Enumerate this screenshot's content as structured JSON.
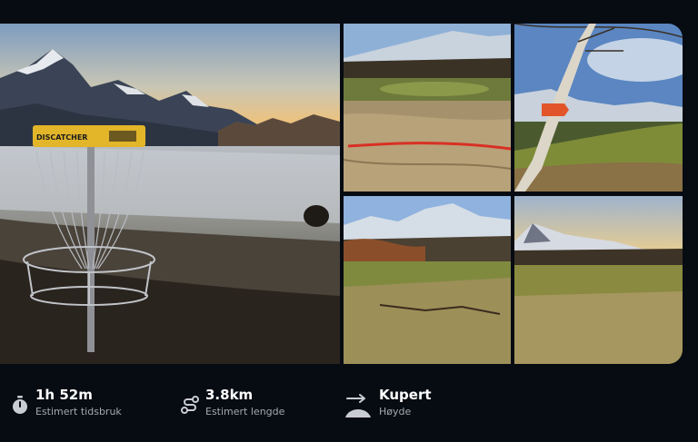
{
  "gallery": {
    "photos": [
      {
        "subject": "disc golf basket in frosty field with mountains",
        "sign_text": "DISCATCHER"
      },
      {
        "subject": "dry grass field with red tape"
      },
      {
        "subject": "birch tree with orange marker"
      },
      {
        "subject": "field with branch and snowy mountains"
      },
      {
        "subject": "open grass field with snowy mountains"
      }
    ]
  },
  "stats": [
    {
      "icon": "stopwatch-icon",
      "value": "1h 52m",
      "label": "Estimert tidsbruk"
    },
    {
      "icon": "route-icon",
      "value": "3.8km",
      "label": "Estimert lengde"
    },
    {
      "icon": "elevation-icon",
      "value": "Kupert",
      "label": "Høyde"
    }
  ],
  "colors": {
    "background": "#070b12",
    "label": "#a3a8b2",
    "value": "#ffffff"
  }
}
